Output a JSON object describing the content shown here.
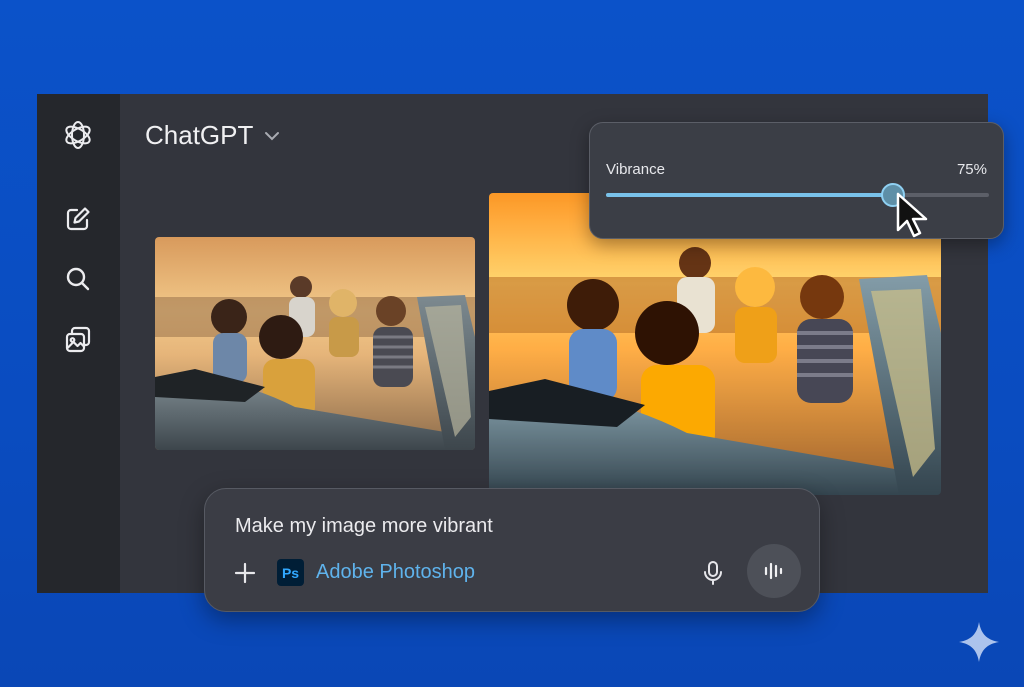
{
  "app": {
    "title": "ChatGPT"
  },
  "sidebar": {
    "items": [
      {
        "icon": "openai-logo-icon"
      },
      {
        "icon": "new-chat-icon"
      },
      {
        "icon": "search-icon"
      },
      {
        "icon": "images-icon"
      }
    ]
  },
  "popover": {
    "label": "Vibrance",
    "value_text": "75%",
    "value": 0.75
  },
  "prompt": {
    "text": "Make my image more vibrant",
    "app_chip_logo": "Ps",
    "app_chip_label": "Adobe Photoshop"
  },
  "colors": {
    "background": "#0b52c9",
    "window": "#33353d",
    "sidebar": "#25272c",
    "slider_fill": "#79c2ea",
    "photoshop_blue": "#31a8ff"
  }
}
